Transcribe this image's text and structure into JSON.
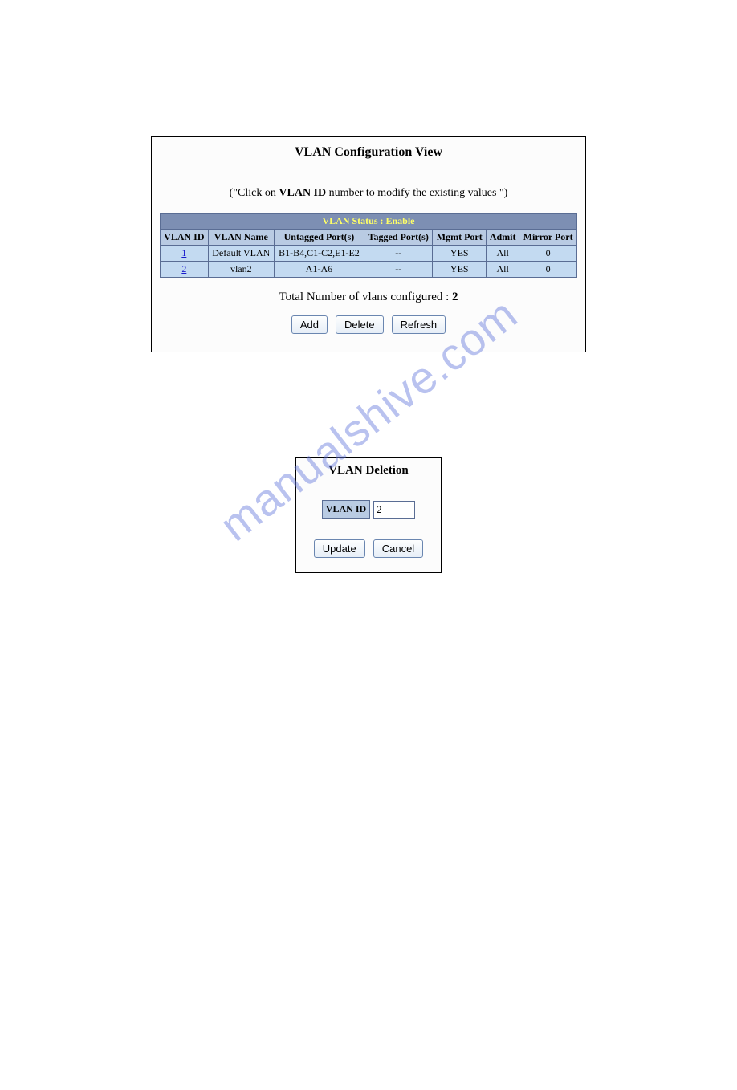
{
  "watermark": "manualshive.com",
  "config": {
    "title": "VLAN Configuration View",
    "subtitle_prefix": "(\"Click on ",
    "subtitle_bold": "VLAN ID",
    "subtitle_suffix": " number to modify the existing values \")",
    "status_label": "VLAN Status   :   Enable",
    "headers": {
      "vlan_id": "VLAN ID",
      "vlan_name": "VLAN Name",
      "untagged": "Untagged Port(s)",
      "tagged": "Tagged Port(s)",
      "mgmt": "Mgmt Port",
      "admit": "Admit",
      "mirror": "Mirror Port"
    },
    "rows": [
      {
        "id": "1",
        "name": "Default VLAN",
        "untagged": "B1-B4,C1-C2,E1-E2",
        "tagged": "--",
        "mgmt": "YES",
        "admit": "All",
        "mirror": "0"
      },
      {
        "id": "2",
        "name": "vlan2",
        "untagged": "A1-A6",
        "tagged": "--",
        "mgmt": "YES",
        "admit": "All",
        "mirror": "0"
      }
    ],
    "total_prefix": "Total Number of vlans configured : ",
    "total_count": "2",
    "buttons": {
      "add": "Add",
      "delete": "Delete",
      "refresh": "Refresh"
    }
  },
  "deletion": {
    "title": "VLAN Deletion",
    "label": "VLAN ID",
    "value": "2",
    "buttons": {
      "update": "Update",
      "cancel": "Cancel"
    }
  }
}
